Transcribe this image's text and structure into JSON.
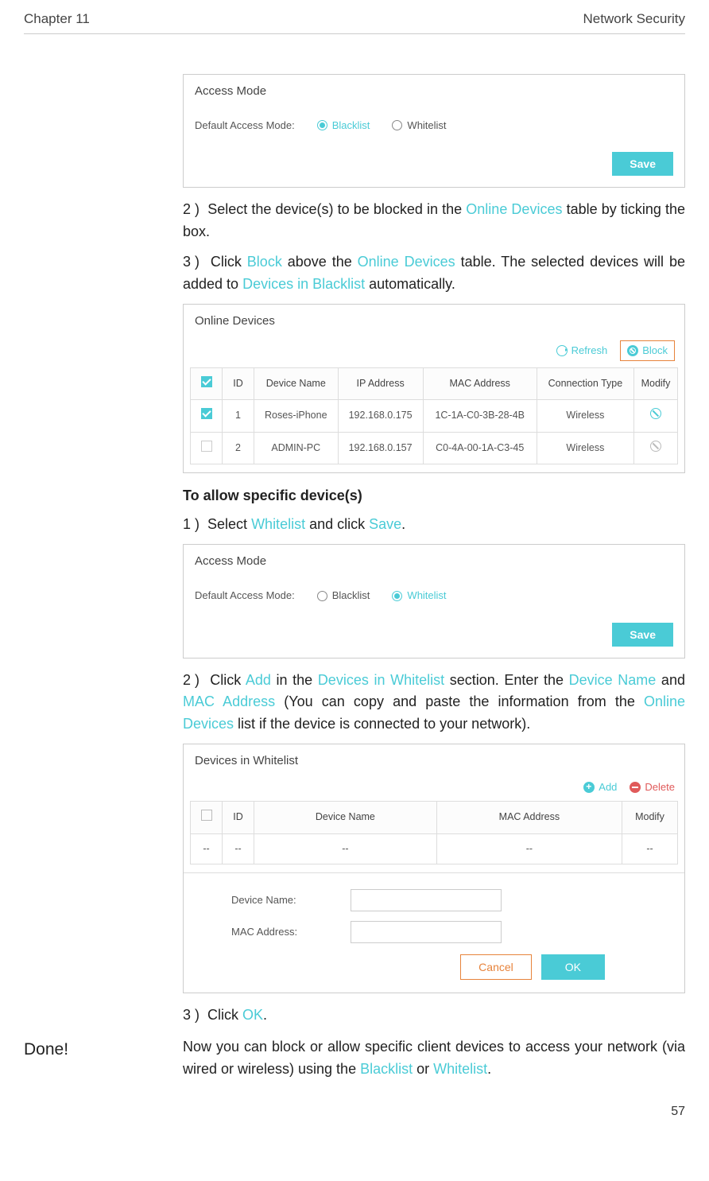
{
  "header": {
    "chapter": "Chapter 11",
    "title": "Network Security"
  },
  "access_mode_panel_1": {
    "title": "Access Mode",
    "label": "Default Access Mode:",
    "opt_blacklist": "Blacklist",
    "opt_whitelist": "Whitelist",
    "save": "Save"
  },
  "instr2": {
    "num": "2 )",
    "pre": "Select the device(s) to be blocked in the ",
    "link": "Online Devices",
    "post": " table by ticking the box."
  },
  "instr3": {
    "num": "3 )",
    "p1": "Click ",
    "block": "Block",
    "p2": " above the ",
    "od": "Online Devices",
    "p3": " table. The selected devices will be added to ",
    "dib": "Devices in Blacklist",
    "p4": " automatically."
  },
  "online_devices": {
    "title": "Online Devices",
    "refresh": "Refresh",
    "block": "Block",
    "cols": {
      "id": "ID",
      "name": "Device Name",
      "ip": "IP Address",
      "mac": "MAC Address",
      "conn": "Connection Type",
      "mod": "Modify"
    },
    "rows": [
      {
        "id": "1",
        "name": "Roses-iPhone",
        "ip": "192.168.0.175",
        "mac": "1C-1A-C0-3B-28-4B",
        "conn": "Wireless"
      },
      {
        "id": "2",
        "name": "ADMIN-PC",
        "ip": "192.168.0.157",
        "mac": "C0-4A-00-1A-C3-45",
        "conn": "Wireless"
      }
    ]
  },
  "allow_heading": "To allow specific device(s)",
  "allow1": {
    "num": "1 )",
    "p1": "Select ",
    "wl": "Whitelist",
    "p2": " and click ",
    "save": "Save",
    "p3": "."
  },
  "access_mode_panel_2": {
    "title": "Access Mode",
    "label": "Default Access Mode:",
    "opt_blacklist": "Blacklist",
    "opt_whitelist": "Whitelist",
    "save": "Save"
  },
  "allow2": {
    "num": "2 )",
    "p1": "Click ",
    "add": "Add",
    "p2": " in the ",
    "diw": "Devices in Whitelist",
    "p3": " section. Enter the ",
    "dn": "Device Name",
    "p4": " and ",
    "mac": "MAC Address",
    "p5": " (You can copy and paste the information from the ",
    "od": "Online Devices",
    "p6": " list if the device is connected to your network)."
  },
  "whitelist_panel": {
    "title": "Devices in Whitelist",
    "add": "Add",
    "delete": "Delete",
    "cols": {
      "id": "ID",
      "name": "Device Name",
      "mac": "MAC Address",
      "mod": "Modify"
    },
    "empty": "--",
    "form": {
      "dn_label": "Device Name:",
      "mac_label": "MAC Address:",
      "cancel": "Cancel",
      "ok": "OK"
    }
  },
  "allow3": {
    "num": "3 )",
    "p1": "Click ",
    "ok": "OK",
    "p2": "."
  },
  "done": {
    "label": "Done!",
    "p1": "Now you can block or allow specific client devices to access your network (via wired or wireless) using the ",
    "bl": "Blacklist",
    "p2": " or ",
    "wl": "Whitelist",
    "p3": "."
  },
  "page_number": "57"
}
